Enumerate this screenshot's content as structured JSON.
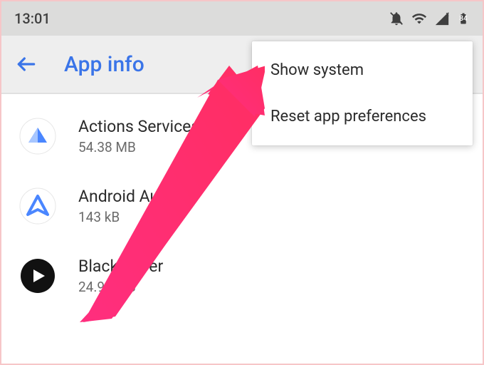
{
  "status_bar": {
    "time": "13:01",
    "battery": "84"
  },
  "app_bar": {
    "title": "App info"
  },
  "apps": [
    {
      "name": "Actions Services",
      "size": "54.38 MB"
    },
    {
      "name": "Android Auto",
      "size": "143 kB"
    },
    {
      "name": "BlackPlayer",
      "size": "24.93 MB"
    }
  ],
  "menu": {
    "items": [
      {
        "label": "Show system"
      },
      {
        "label": "Reset app preferences"
      }
    ]
  }
}
